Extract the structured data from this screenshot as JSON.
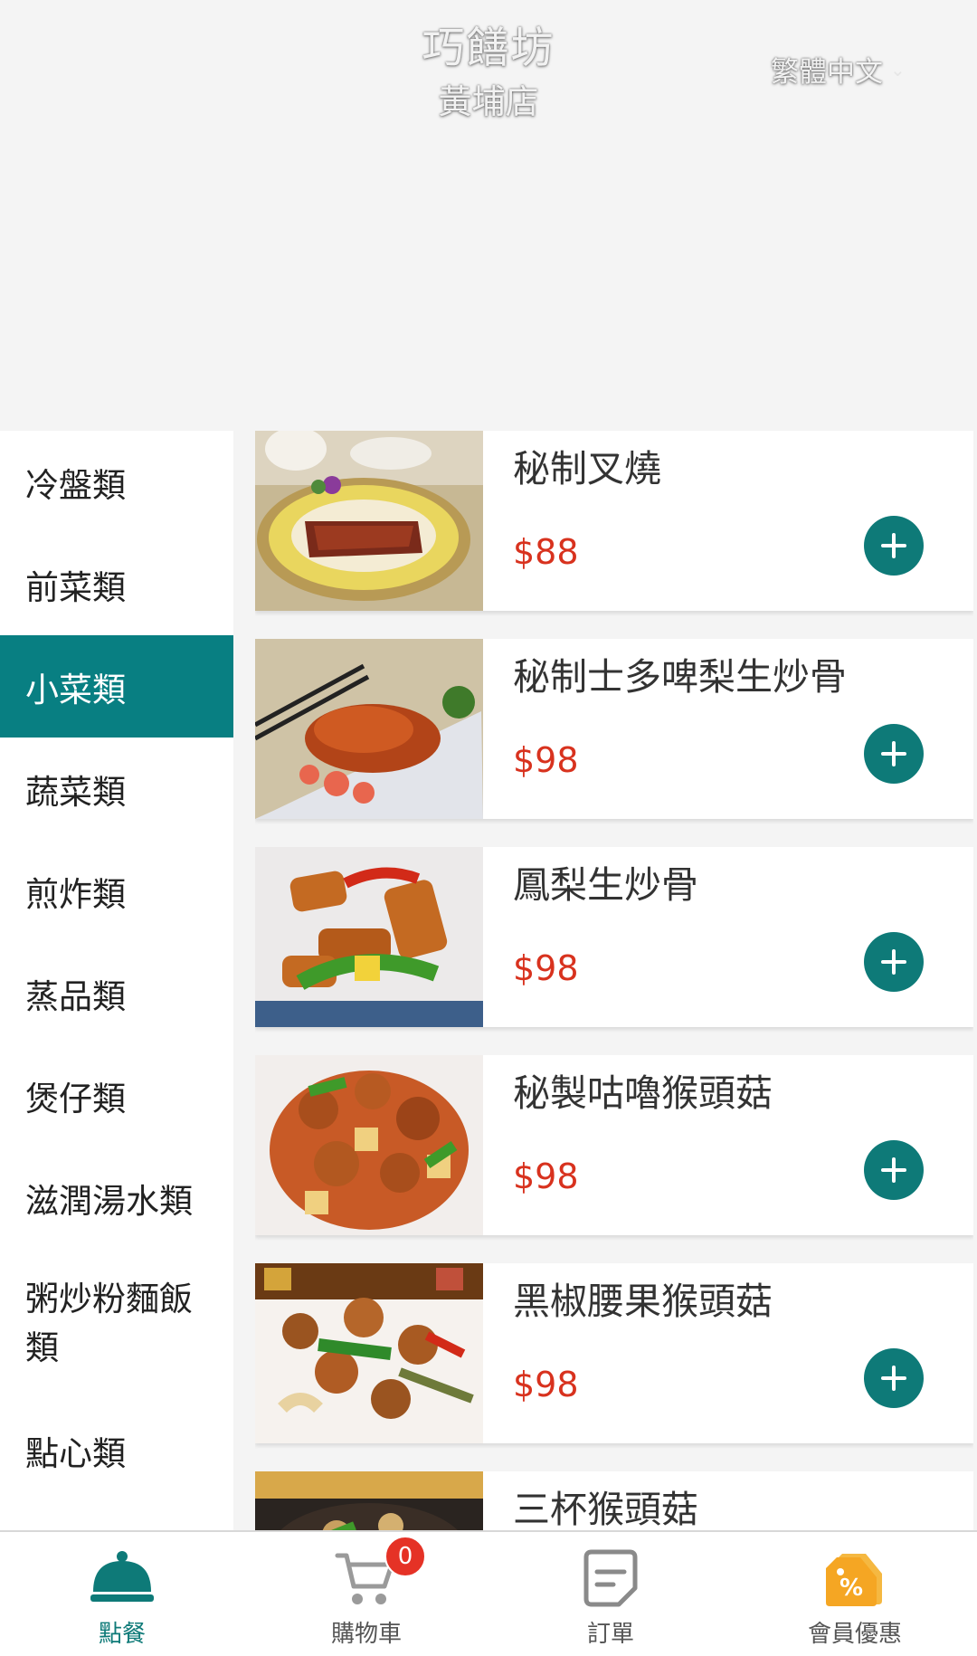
{
  "header": {
    "shop_name": "巧饍坊",
    "branch_name": "黃埔店",
    "language": "繁體中文"
  },
  "sidebar": {
    "active_index": 2,
    "categories": [
      {
        "label": "冷盤類"
      },
      {
        "label": "前菜類"
      },
      {
        "label": "小菜類"
      },
      {
        "label": "蔬菜類"
      },
      {
        "label": "煎炸類"
      },
      {
        "label": "蒸品類"
      },
      {
        "label": "煲仔類"
      },
      {
        "label": "滋潤湯水類"
      },
      {
        "label": "粥炒粉麵飯類"
      },
      {
        "label": "點心類"
      }
    ]
  },
  "menu": {
    "items": [
      {
        "name": "秘制叉燒",
        "price": "$88",
        "image": "char-siu-photo"
      },
      {
        "name": "秘制士多啤梨生炒骨",
        "price": "$98",
        "image": "strawberry-pork-photo"
      },
      {
        "name": "鳳梨生炒骨",
        "price": "$98",
        "image": "pineapple-pork-photo"
      },
      {
        "name": "秘製咕嚕猴頭菇",
        "price": "$98",
        "image": "sweet-sour-mushroom-photo"
      },
      {
        "name": "黑椒腰果猴頭菇",
        "price": "$98",
        "image": "pepper-cashew-mushroom-photo"
      },
      {
        "name": "三杯猴頭菇",
        "price": "",
        "image": "three-cup-mushroom-photo"
      }
    ]
  },
  "bottom_nav": {
    "items": [
      {
        "label": "點餐",
        "icon": "cloche-icon"
      },
      {
        "label": "購物車",
        "icon": "cart-icon"
      },
      {
        "label": "訂單",
        "icon": "order-icon"
      },
      {
        "label": "會員優惠",
        "icon": "coupon-icon"
      }
    ],
    "cart_count": "0"
  },
  "colors": {
    "accent": "#0e7a78",
    "active_category": "#087f82",
    "price": "#d8321e",
    "badge": "#e53226",
    "coupon": "#f5a623"
  }
}
